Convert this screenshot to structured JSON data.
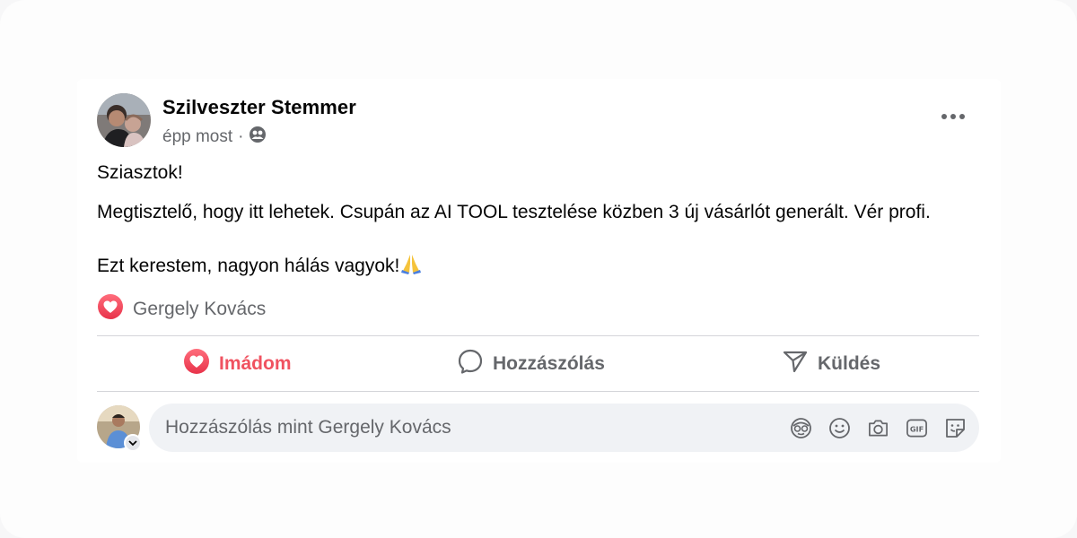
{
  "post": {
    "author": "Szilveszter Stemmer",
    "timestamp": "épp most",
    "separator": "·",
    "audience_icon": "friends-icon",
    "paragraph1": "Sziasztok!",
    "paragraph2": "Megtisztelő, hogy itt lehetek. Csupán az AI TOOL tesztelése közben 3 új vásárlót generált. Vér profi.",
    "paragraph3": "Ezt kerestem, nagyon hálás vagyok!",
    "emoji": "folded-hands-icon"
  },
  "reactions": {
    "type": "love",
    "names": "Gergely Kovács"
  },
  "actions": {
    "love_label": "Imádom",
    "comment_label": "Hozzászólás",
    "send_label": "Küldés"
  },
  "composer": {
    "placeholder": "Hozzászólás mint Gergely Kovács",
    "tools": [
      "avatar-sticker-icon",
      "emoji-icon",
      "camera-icon",
      "gif-icon",
      "sticker-icon"
    ]
  },
  "colors": {
    "love": "#f05260",
    "muted_text": "#65676b",
    "composer_bg": "#f0f2f5"
  }
}
